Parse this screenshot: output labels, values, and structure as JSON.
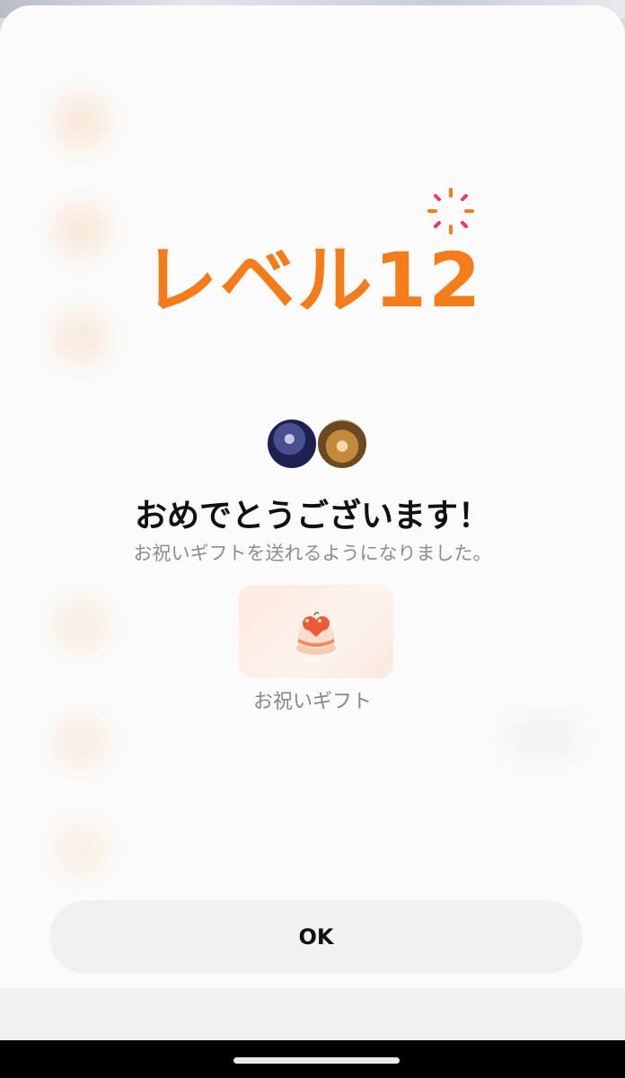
{
  "modal": {
    "level_title": "レベル12",
    "congrats_title": "おめでとうございます！",
    "subtitle": "お祝いギフトを送れるようになりました。",
    "gift_label": "お祝いギフト",
    "ok_label": "OK"
  },
  "icons": {
    "sparkle": "sparkle-icon",
    "gift": "cake-gift-icon"
  },
  "colors": {
    "accent": "#f47c1a",
    "sheet_background": "#fbfbfb",
    "button_background": "#f1f1f1"
  }
}
